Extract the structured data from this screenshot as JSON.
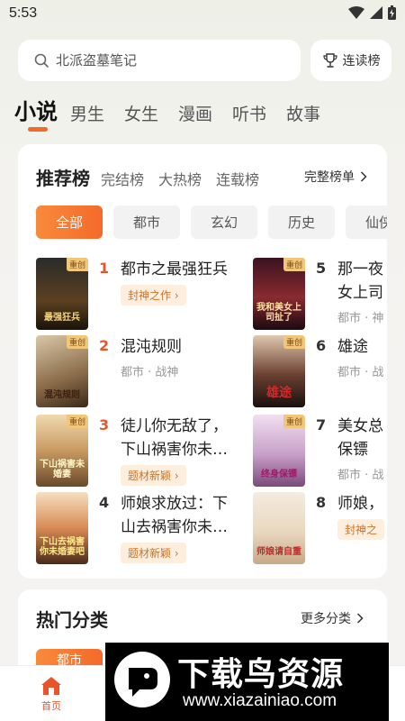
{
  "status": {
    "time": "5:53"
  },
  "search": {
    "placeholder": "北派盗墓笔记",
    "rank_label": "连读榜"
  },
  "categories": [
    "小说",
    "男生",
    "女生",
    "漫画",
    "听书",
    "故事"
  ],
  "ranking": {
    "tabs": [
      "推荐榜",
      "完结榜",
      "大热榜",
      "连载榜"
    ],
    "full_label": "完整榜单",
    "filters": [
      "全部",
      "都市",
      "玄幻",
      "历史",
      "仙侠"
    ],
    "books": [
      {
        "rank": "1",
        "title": "都市之最强狂兵",
        "tag": "封神之作",
        "cover_tag": "重创",
        "cover_text": "最强狂兵"
      },
      {
        "rank": "2",
        "title": "混沌规则",
        "meta": "都市 · 战神",
        "cover_tag": "重创",
        "cover_text": "混沌规则"
      },
      {
        "rank": "3",
        "title": "徒儿你无敌了，下山祸害你未…",
        "tag": "题材新颖",
        "cover_tag": "重创",
        "cover_text": "下山祸害未婚妻"
      },
      {
        "rank": "4",
        "title": "师娘求放过：下山去祸害你未…",
        "tag": "题材新颖",
        "cover_text": "下山去祸害你未婚妻吧"
      },
      {
        "rank": "5",
        "title": "那一夜女上司",
        "meta": "都市 · 神",
        "cover_tag": "重创",
        "cover_text": "我和美女上司扯了"
      },
      {
        "rank": "6",
        "title": "雄途",
        "meta": "都市 · 战",
        "cover_tag": "重创",
        "cover_text": "雄途"
      },
      {
        "rank": "7",
        "title": "美女总保镖",
        "meta": "都市 · 战",
        "cover_tag": "重创",
        "cover_text": "终身保镖"
      },
      {
        "rank": "8",
        "title": "师娘，",
        "tag": "封神之",
        "cover_text": "师娘请自重"
      }
    ]
  },
  "hot": {
    "title": "热门分类",
    "more_label": "更多分类",
    "first_chip": "都市"
  },
  "nav": {
    "home": "首页"
  },
  "watermark": {
    "brand": "下载鸟资源",
    "url": "www.xiazainiao.com"
  },
  "colors": {
    "accent": "#f26a2a",
    "tag_bg": "#fdeede",
    "tag_text": "#c8742e"
  }
}
